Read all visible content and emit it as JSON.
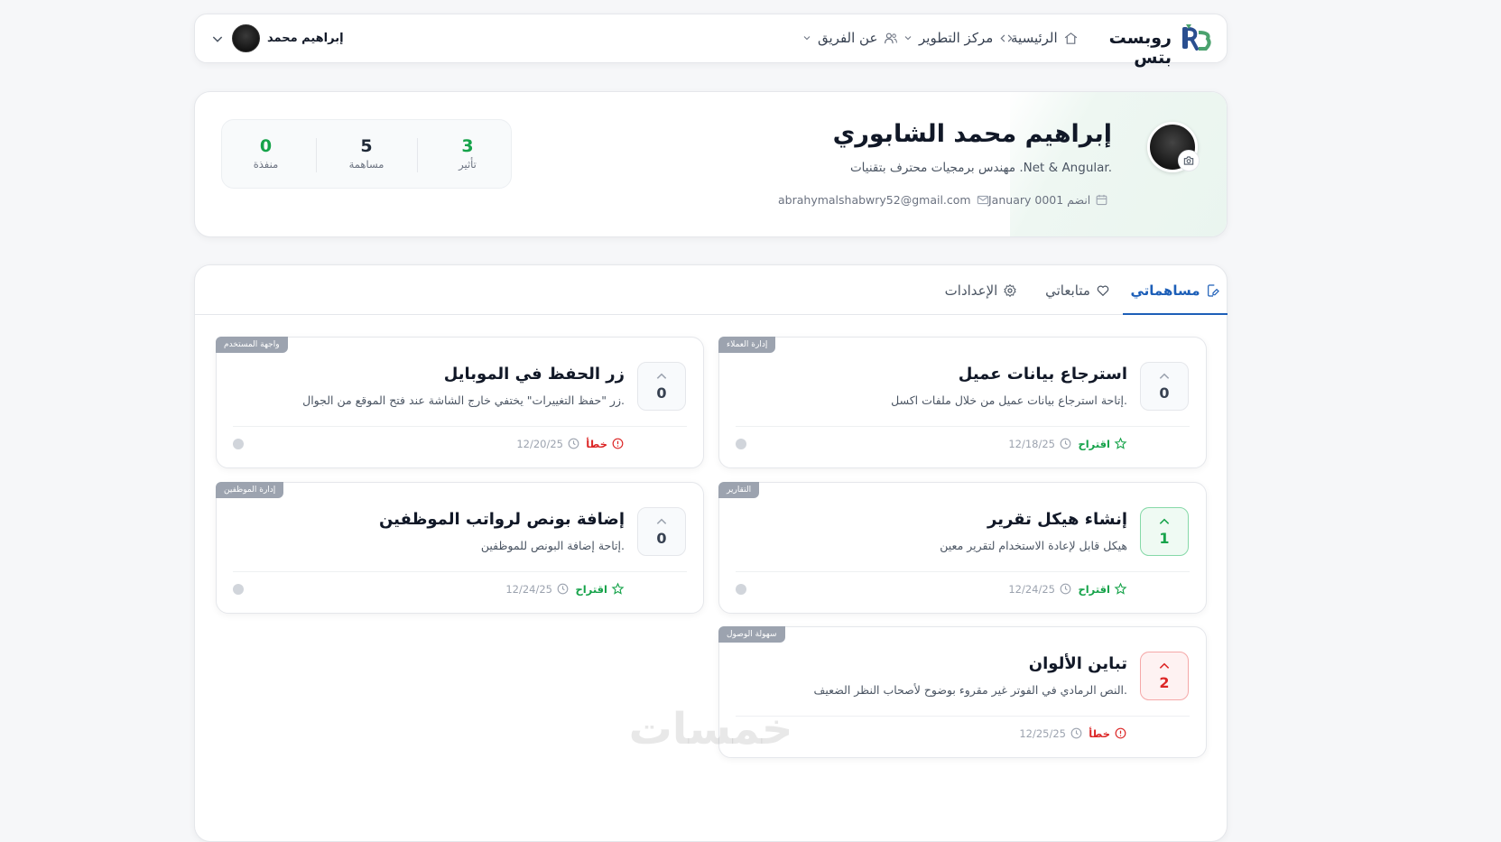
{
  "header": {
    "brand": "روبست بتس",
    "nav": [
      {
        "label": "الرئيسية"
      },
      {
        "label": "مركز التطوير"
      },
      {
        "label": "عن الفريق"
      }
    ],
    "user_name": "إبراهيم محمد"
  },
  "profile": {
    "name": "إبراهيم محمد الشابوري",
    "bio": "مهندس برمجيات محترف بتقنيات .Net & Angular.",
    "joined": "انضم January 0001",
    "email": "abrahymalshabwry52@gmail.com",
    "stats": [
      {
        "value": "3",
        "label": "تأثير"
      },
      {
        "value": "5",
        "label": "مساهمة"
      },
      {
        "value": "0",
        "label": "منفذة"
      }
    ]
  },
  "tabs": [
    {
      "label": "مساهماتي",
      "active": true
    },
    {
      "label": "متابعاتي",
      "active": false
    },
    {
      "label": "الإعدادات",
      "active": false
    }
  ],
  "cards": [
    {
      "tag": "إدارة العملاء",
      "title": "استرجاع بيانات عميل",
      "desc": "إتاحة استرجاع بيانات عميل من خلال ملفات اكسل.",
      "votes": "0",
      "vote_state": "neutral",
      "type": "اقتراح",
      "type_kind": "suggestion",
      "date": "12/18/25"
    },
    {
      "tag": "واجهة المستخدم",
      "title": "زر الحفظ في الموبايل",
      "desc": "زر \"حفظ التغييرات\" يختفي خارج الشاشة عند فتح الموقع من الجوال.",
      "votes": "0",
      "vote_state": "neutral",
      "type": "خطأ",
      "type_kind": "bug",
      "date": "12/20/25"
    },
    {
      "tag": "التقارير",
      "title": "إنشاء هيكل تقرير",
      "desc": "هيكل قابل لإعادة الاستخدام لتقرير معين",
      "votes": "1",
      "vote_state": "up",
      "type": "اقتراح",
      "type_kind": "suggestion",
      "date": "12/24/25"
    },
    {
      "tag": "إدارة الموظفين",
      "title": "إضافة بونص لرواتب الموظفين",
      "desc": "إتاحة إضافة البونص للموظفين.",
      "votes": "0",
      "vote_state": "neutral",
      "type": "اقتراح",
      "type_kind": "suggestion",
      "date": "12/24/25"
    },
    {
      "tag": "سهولة الوصول",
      "title": "تباين الألوان",
      "desc": "النص الرمادي في الفوتر غير مقروء بوضوح لأصحاب النظر الضعيف.",
      "votes": "2",
      "vote_state": "down",
      "type": "خطأ",
      "type_kind": "bug",
      "date": "12/25/25"
    }
  ],
  "watermark": "خمسات",
  "colors": {
    "accent": "#1d5fb8",
    "green": "#16a34a",
    "red": "#dc2626",
    "tag_bg": "#9ca3af"
  }
}
